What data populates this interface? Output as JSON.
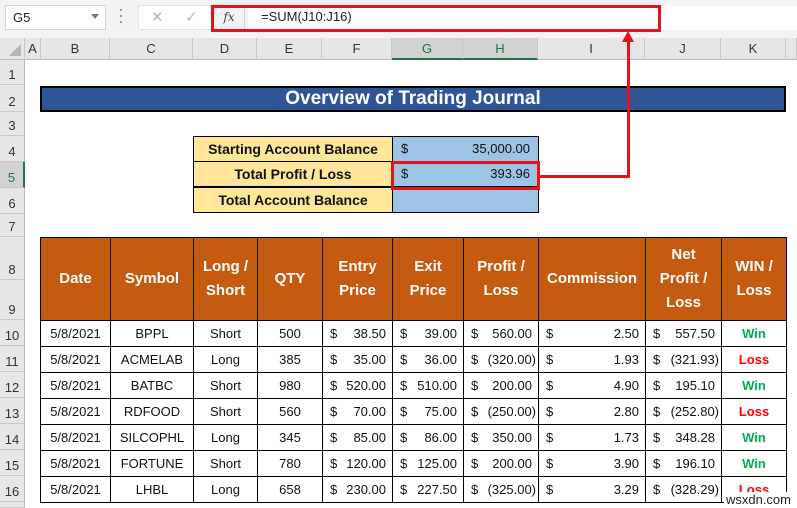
{
  "formula_bar": {
    "name_box": "G5",
    "cancel_icon": "✕",
    "enter_icon": "✓",
    "fx_label": "fx",
    "formula": "=SUM(J10:J16)"
  },
  "columns": [
    "A",
    "B",
    "C",
    "D",
    "E",
    "F",
    "G",
    "H",
    "I",
    "J",
    "K"
  ],
  "selected_columns": [
    "G",
    "H"
  ],
  "rows": [
    "1",
    "2",
    "3",
    "4",
    "5",
    "6",
    "7",
    "8",
    "9",
    "10",
    "11",
    "12",
    "13",
    "14",
    "15",
    "16"
  ],
  "selected_row": "5",
  "title": "Overview of Trading Journal",
  "summary": [
    {
      "label": "Starting Account Balance",
      "currency": "$",
      "value": "35,000.00"
    },
    {
      "label": "Total Profit / Loss",
      "currency": "$",
      "value": "393.96"
    },
    {
      "label": "Total Account Balance",
      "currency": "",
      "value": ""
    }
  ],
  "table": {
    "headers": [
      "Date",
      "Symbol",
      "Long / Short",
      "QTY",
      "Entry Price",
      "Exit Price",
      "Profit / Loss",
      "Commission",
      "Net Profit / Loss",
      "WIN / Loss"
    ],
    "rows": [
      {
        "date": "5/8/2021",
        "symbol": "BPPL",
        "side": "Short",
        "qty": "500",
        "entry": "38.50",
        "exit": "39.00",
        "pl": "560.00",
        "commission": "2.50",
        "net": "557.50",
        "result": "Win"
      },
      {
        "date": "5/8/2021",
        "symbol": "ACMELAB",
        "side": "Long",
        "qty": "385",
        "entry": "35.00",
        "exit": "36.00",
        "pl": "(320.00)",
        "commission": "1.93",
        "net": "(321.93)",
        "result": "Loss"
      },
      {
        "date": "5/8/2021",
        "symbol": "BATBC",
        "side": "Short",
        "qty": "980",
        "entry": "520.00",
        "exit": "510.00",
        "pl": "200.00",
        "commission": "4.90",
        "net": "195.10",
        "result": "Win"
      },
      {
        "date": "5/8/2021",
        "symbol": "RDFOOD",
        "side": "Short",
        "qty": "560",
        "entry": "70.00",
        "exit": "75.00",
        "pl": "(250.00)",
        "commission": "2.80",
        "net": "(252.80)",
        "result": "Loss"
      },
      {
        "date": "5/8/2021",
        "symbol": "SILCOPHL",
        "side": "Long",
        "qty": "345",
        "entry": "85.00",
        "exit": "86.00",
        "pl": "350.00",
        "commission": "1.73",
        "net": "348.28",
        "result": "Win"
      },
      {
        "date": "5/8/2021",
        "symbol": "FORTUNE",
        "side": "Short",
        "qty": "780",
        "entry": "120.00",
        "exit": "125.00",
        "pl": "200.00",
        "commission": "3.90",
        "net": "196.10",
        "result": "Win"
      },
      {
        "date": "5/8/2021",
        "symbol": "LHBL",
        "side": "Long",
        "qty": "658",
        "entry": "230.00",
        "exit": "227.50",
        "pl": "(325.00)",
        "commission": "3.29",
        "net": "(328.29)",
        "result": "Loss"
      }
    ],
    "currency": "$"
  },
  "colors": {
    "title_bg": "#2f5597",
    "header_bg": "#c55a11",
    "label_bg": "#ffe699",
    "value_bg": "#9dc3e6",
    "win": "#00b050",
    "loss": "#ff0000",
    "annotation": "#e0141b"
  },
  "watermark": "wsxdn.com"
}
